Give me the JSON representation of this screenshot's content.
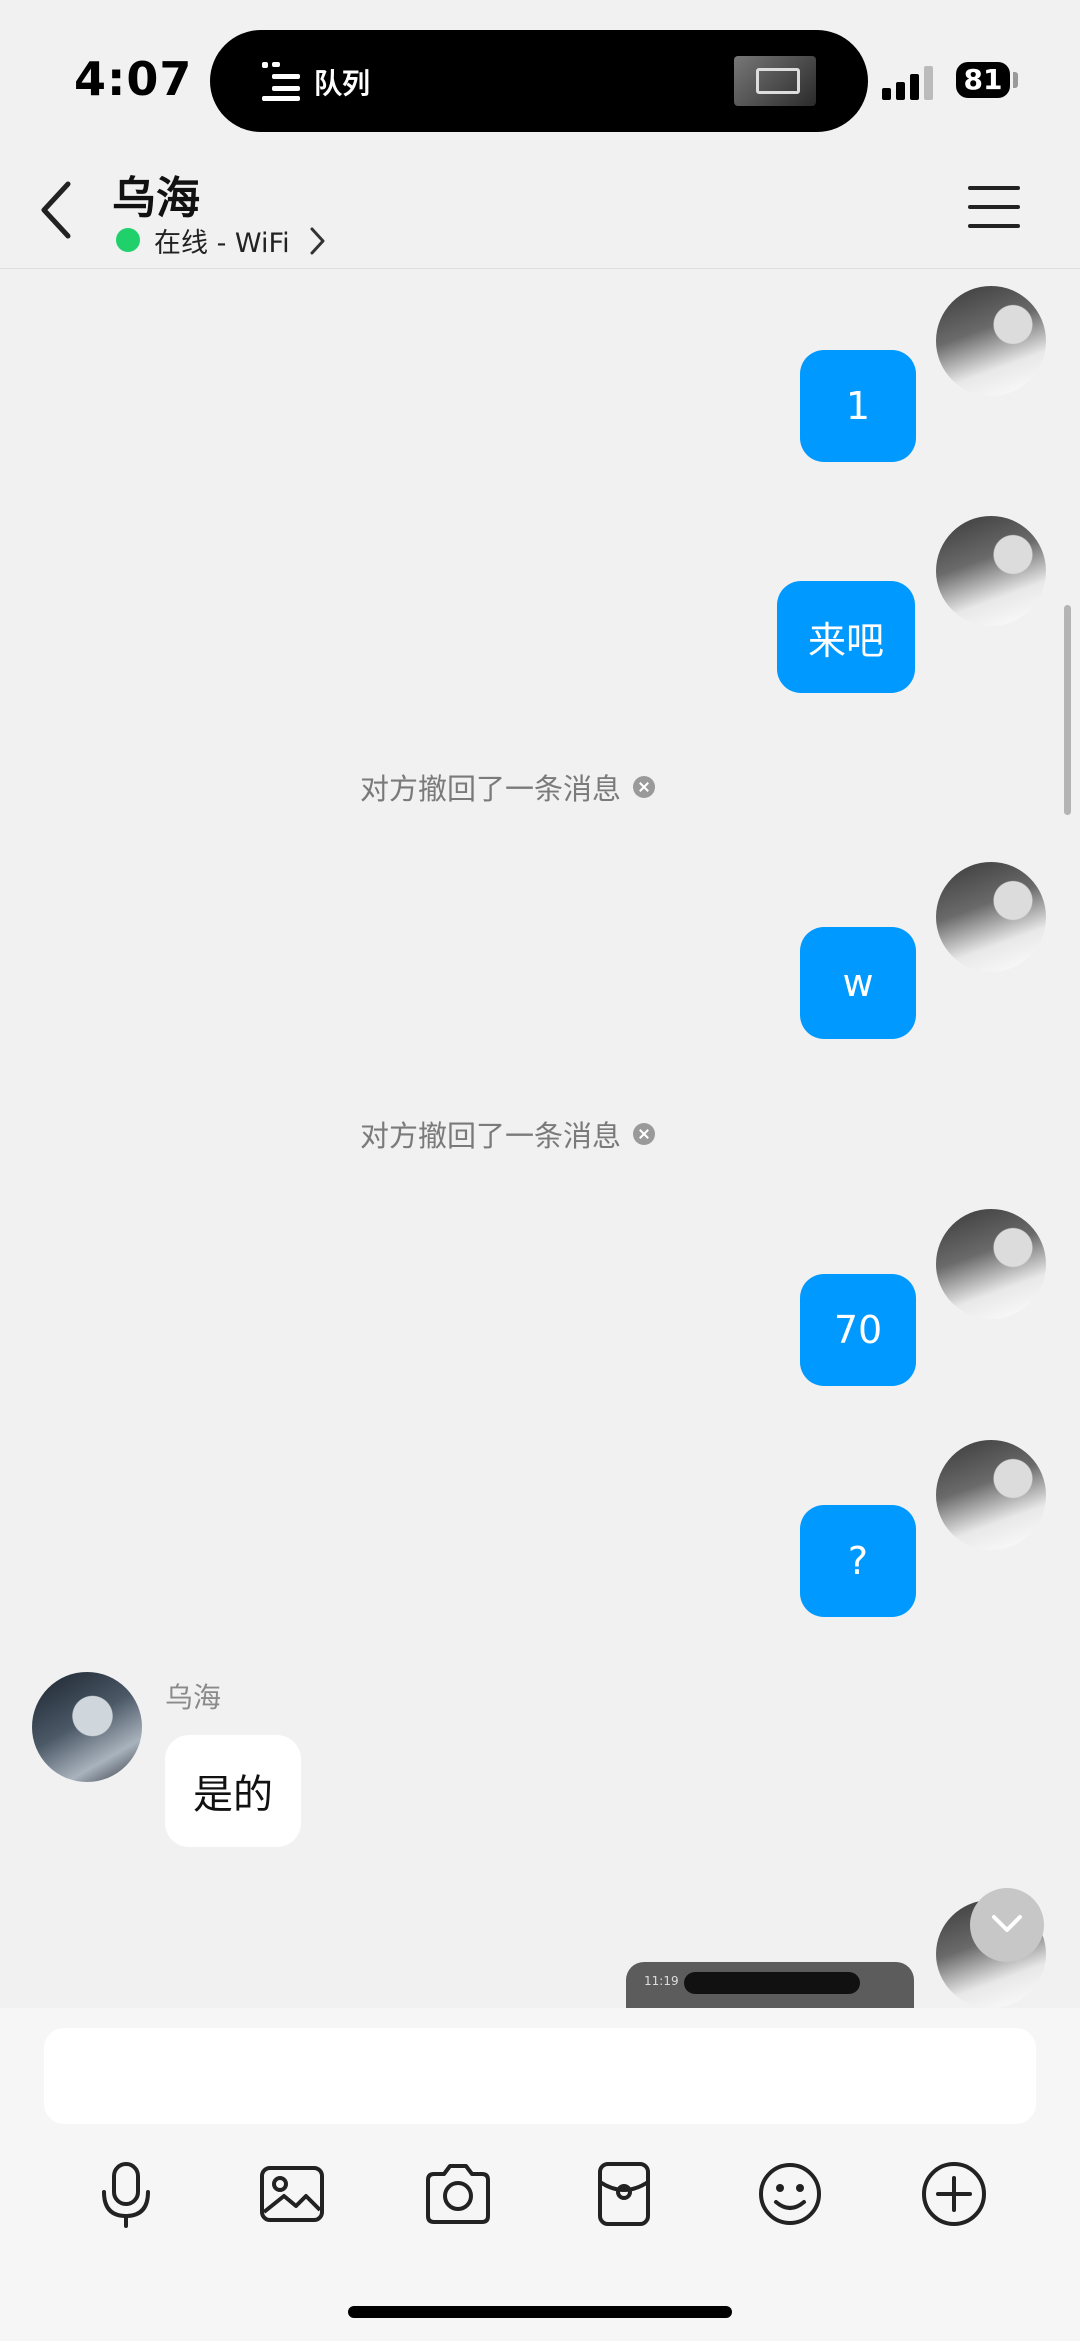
{
  "status_bar": {
    "time": "4:07",
    "island_label": "队列",
    "battery": "81"
  },
  "header": {
    "contact_name": "乌海",
    "status_text": "在线 - WiFi"
  },
  "messages": {
    "m1": "1",
    "m2": "来吧",
    "sys1": "对方撤回了一条消息",
    "m3": "w",
    "sys2": "对方撤回了一条消息",
    "m4": "70",
    "m5": "?",
    "other_sender": "乌海",
    "other_text": "是的"
  },
  "mini_screenshot": {
    "time": "11:19"
  },
  "input": {
    "placeholder": ""
  },
  "toolbar": {
    "icons": [
      "microphone-icon",
      "image-icon",
      "camera-icon",
      "red-packet-icon",
      "emoji-icon",
      "plus-icon"
    ]
  },
  "colors": {
    "accent": "#0099ff",
    "online": "#1fd06b",
    "background": "#f1f1f1"
  }
}
